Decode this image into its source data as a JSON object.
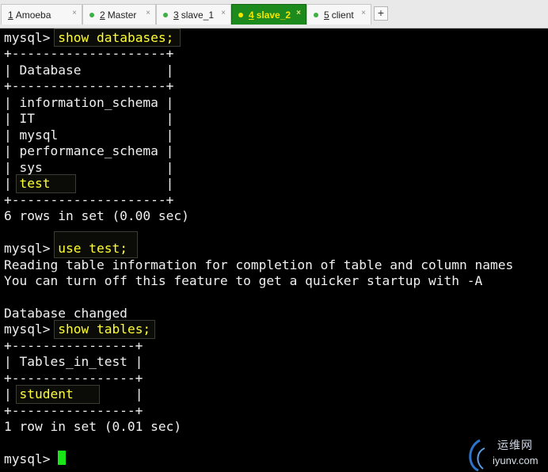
{
  "tabs": [
    {
      "num": "1",
      "label": "Amoeba",
      "close": "×"
    },
    {
      "num": "2",
      "label": "Master",
      "close": "×"
    },
    {
      "num": "3",
      "label": "slave_1",
      "close": "×"
    },
    {
      "num": "4",
      "label": "slave_2",
      "close": "×"
    },
    {
      "num": "5",
      "label": "client",
      "close": "×"
    }
  ],
  "new_tab_label": "+",
  "colors": {
    "active_tab_bg": "#1d8a1d",
    "active_tab_text": "#f4e700",
    "tab_dot": "#3cb043",
    "command_text": "#ffff33",
    "output_text": "#f0f0f0",
    "terminal_bg": "#000000",
    "cursor": "#19e619"
  },
  "terminal": {
    "prompt": "mysql> ",
    "lines": [
      {
        "prompt": "mysql> ",
        "cmd": "show databases;"
      },
      {
        "text": "+--------------------+"
      },
      {
        "text": "| Database           |"
      },
      {
        "text": "+--------------------+"
      },
      {
        "text": "| information_schema |"
      },
      {
        "text": "| IT                 |"
      },
      {
        "text": "| mysql              |"
      },
      {
        "text": "| performance_schema |"
      },
      {
        "text": "| sys                |"
      },
      {
        "pre": "| ",
        "cmd": "test",
        "post": "               |"
      },
      {
        "text": "+--------------------+"
      },
      {
        "text": "6 rows in set (0.00 sec)"
      },
      {
        "text": ""
      },
      {
        "prompt": "mysql> ",
        "cmd": "use test;"
      },
      {
        "text": "Reading table information for completion of table and column names"
      },
      {
        "text": "You can turn off this feature to get a quicker startup with -A"
      },
      {
        "text": ""
      },
      {
        "text": "Database changed"
      },
      {
        "prompt": "mysql> ",
        "cmd": "show tables;"
      },
      {
        "text": "+----------------+"
      },
      {
        "text": "| Tables_in_test |"
      },
      {
        "text": "+----------------+"
      },
      {
        "pre": "| ",
        "cmd": "student",
        "post": "        |"
      },
      {
        "text": "+----------------+"
      },
      {
        "text": "1 row in set (0.01 sec)"
      },
      {
        "text": ""
      },
      {
        "prompt": "mysql> "
      }
    ]
  },
  "watermark": {
    "chinese": "运维网",
    "url": "iyunv.com"
  }
}
